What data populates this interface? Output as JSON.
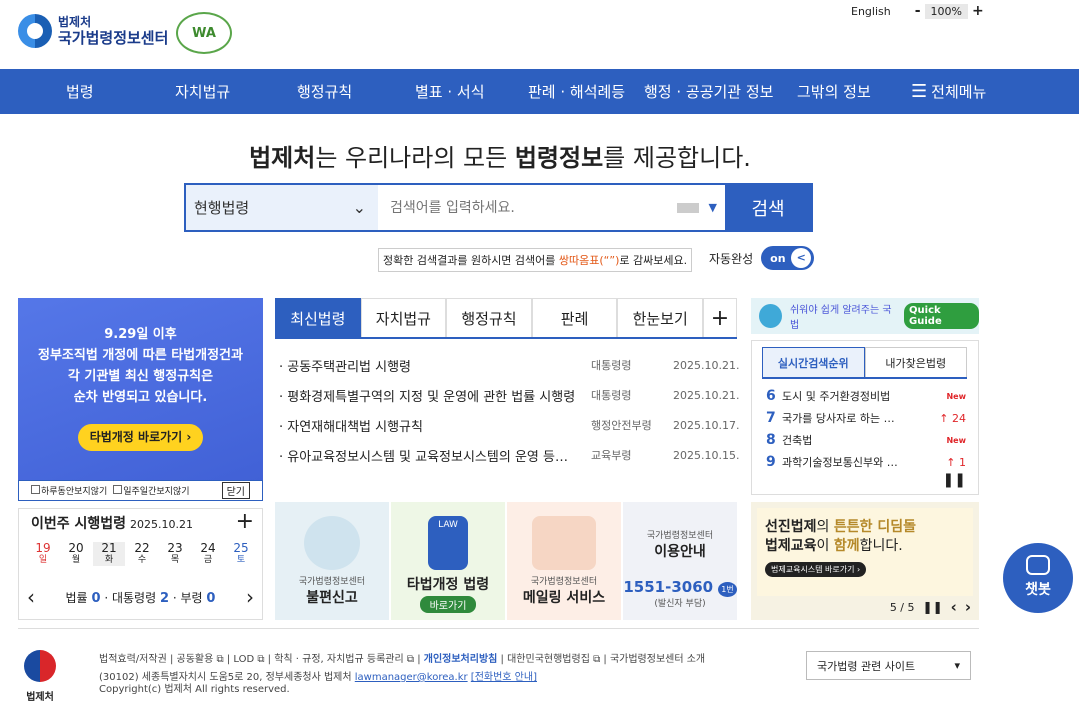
{
  "header": {
    "org_small": "법제처",
    "org_big": "국가법령정보센터",
    "wa_badge": "WA",
    "english": "English",
    "zoom_minus": "-",
    "zoom_value": "100%",
    "zoom_plus": "+"
  },
  "nav": {
    "items": [
      "법령",
      "자치법규",
      "행정규칙",
      "별표 · 서식",
      "판례 · 해석례등",
      "행정 · 공공기관 정보",
      "그밖의 정보"
    ],
    "menu_all": "전체메뉴"
  },
  "hero": {
    "part1": "법제처",
    "part2": "는 우리나라의 모든 ",
    "part3": "법령정보",
    "part4": "를 제공합니다."
  },
  "search": {
    "category": "현행법령",
    "placeholder": "검색어를 입력하세요.",
    "button": "검색"
  },
  "tip": {
    "before": "정확한 검색결과를 원하시면 검색어를 ",
    "em": "쌍따옴표(“”)",
    "after": "로 감싸보세요."
  },
  "autocomplete": {
    "label": "자동완성",
    "state": "on",
    "knob": "<"
  },
  "banner": {
    "lines": [
      "9.29일 이후",
      "정부조직법 개정에 따른 타법개정건과",
      "각 기관별 최신 행정규칙은",
      "순차 반영되고 있습니다."
    ],
    "button": "타법개정 바로가기 ›",
    "no_today": "하루동안보지않기",
    "no_week": "일주일간보지않기",
    "close": "닫기"
  },
  "week": {
    "title": "이번주 시행법령",
    "date": "2025.10.21",
    "plus": "+",
    "days": [
      {
        "num": "19",
        "wd": "일"
      },
      {
        "num": "20",
        "wd": "월"
      },
      {
        "num": "21",
        "wd": "화"
      },
      {
        "num": "22",
        "wd": "수"
      },
      {
        "num": "23",
        "wd": "목"
      },
      {
        "num": "24",
        "wd": "금"
      },
      {
        "num": "25",
        "wd": "토"
      }
    ],
    "law_label": "법률",
    "law_count": "0",
    "decree_label": "대통령령",
    "decree_count": "2",
    "rule_label": "부령",
    "rule_count": "0",
    "sep": "·",
    "prev": "‹",
    "next": "›"
  },
  "tabs": [
    "최신법령",
    "자치법규",
    "행정규칙",
    "판례",
    "한눈보기"
  ],
  "tabs_plus": "+",
  "laws": [
    {
      "title": "· 공동주택관리법 시행령",
      "dept": "대통령령",
      "date": "2025.10.21."
    },
    {
      "title": "· 평화경제특별구역의 지정 및 운영에 관한 법률 시행령",
      "dept": "대통령령",
      "date": "2025.10.21."
    },
    {
      "title": "· 자연재해대책법 시행규칙",
      "dept": "행정안전부령",
      "date": "2025.10.17."
    },
    {
      "title": "· 유아교육정보시스템 및 교육정보시스템의 운영 등…",
      "dept": "교육부령",
      "date": "2025.10.15."
    }
  ],
  "cards": {
    "c1_small": "국가법령정보센터",
    "c1_big": "불편신고",
    "c2_big": "타법개정 법령",
    "c2_btn": "바로가기",
    "c2_law": "LAW",
    "c3_small": "국가법령정보센터",
    "c3_big": "메일링 서비스",
    "c4_small": "국가법령정보센터",
    "c4_big": "이용안내",
    "c4_phone": "1551-3060",
    "c4_badge": "1번",
    "c4_note": "(발신자 부담)"
  },
  "quickguide": {
    "text": "쉬워야 쉽게 알려주는 국법",
    "button": "Quick Guide"
  },
  "rank": {
    "tabs": [
      "실시간검색순위",
      "내가찾은법령"
    ],
    "items": [
      {
        "n": "6",
        "t": "도시 및 주거환경정비법",
        "mark": "New"
      },
      {
        "n": "7",
        "t": "국가를 당사자로 하는 …",
        "mark": "↑ 24"
      },
      {
        "n": "8",
        "t": "건축법",
        "mark": "New"
      },
      {
        "n": "9",
        "t": "과학기술정보통신부와 …",
        "mark": "↑ 1"
      }
    ],
    "pause": "❚❚"
  },
  "edu": {
    "l1a": "선진법제",
    "l1b": "의 ",
    "l1c": "튼튼한 디딤돌",
    "l2a": "법제교육",
    "l2b": "이 ",
    "l2c": "함께",
    "l2d": "합니다.",
    "button": "법제교육시스템 바로가기 ›",
    "page": "5 / 5",
    "pause": "❚❚",
    "prev": "‹",
    "next": "›"
  },
  "chatbot": {
    "label": "챗봇"
  },
  "footer": {
    "org": "법제처",
    "links": [
      "법적효력/저작권",
      "공동활용 ⧉",
      "LOD ⧉",
      "학칙 · 규정, 자치법규 등록관리 ⧉"
    ],
    "privacy": "개인정보처리방침",
    "links2": [
      "대한민국현행법령집 ⧉",
      "국가법령정보센터 소개"
    ],
    "addr": "(30102) 세종특별자치시 도움5로 20, 정부세종청사 법제처 ",
    "email": "lawmanager@korea.kr",
    "phone_info": "[전화번호 안내]",
    "copyright": "Copyright(c) 법제처 All rights reserved.",
    "related": "국가법령 관련 사이트",
    "related_arrow": "▾"
  }
}
